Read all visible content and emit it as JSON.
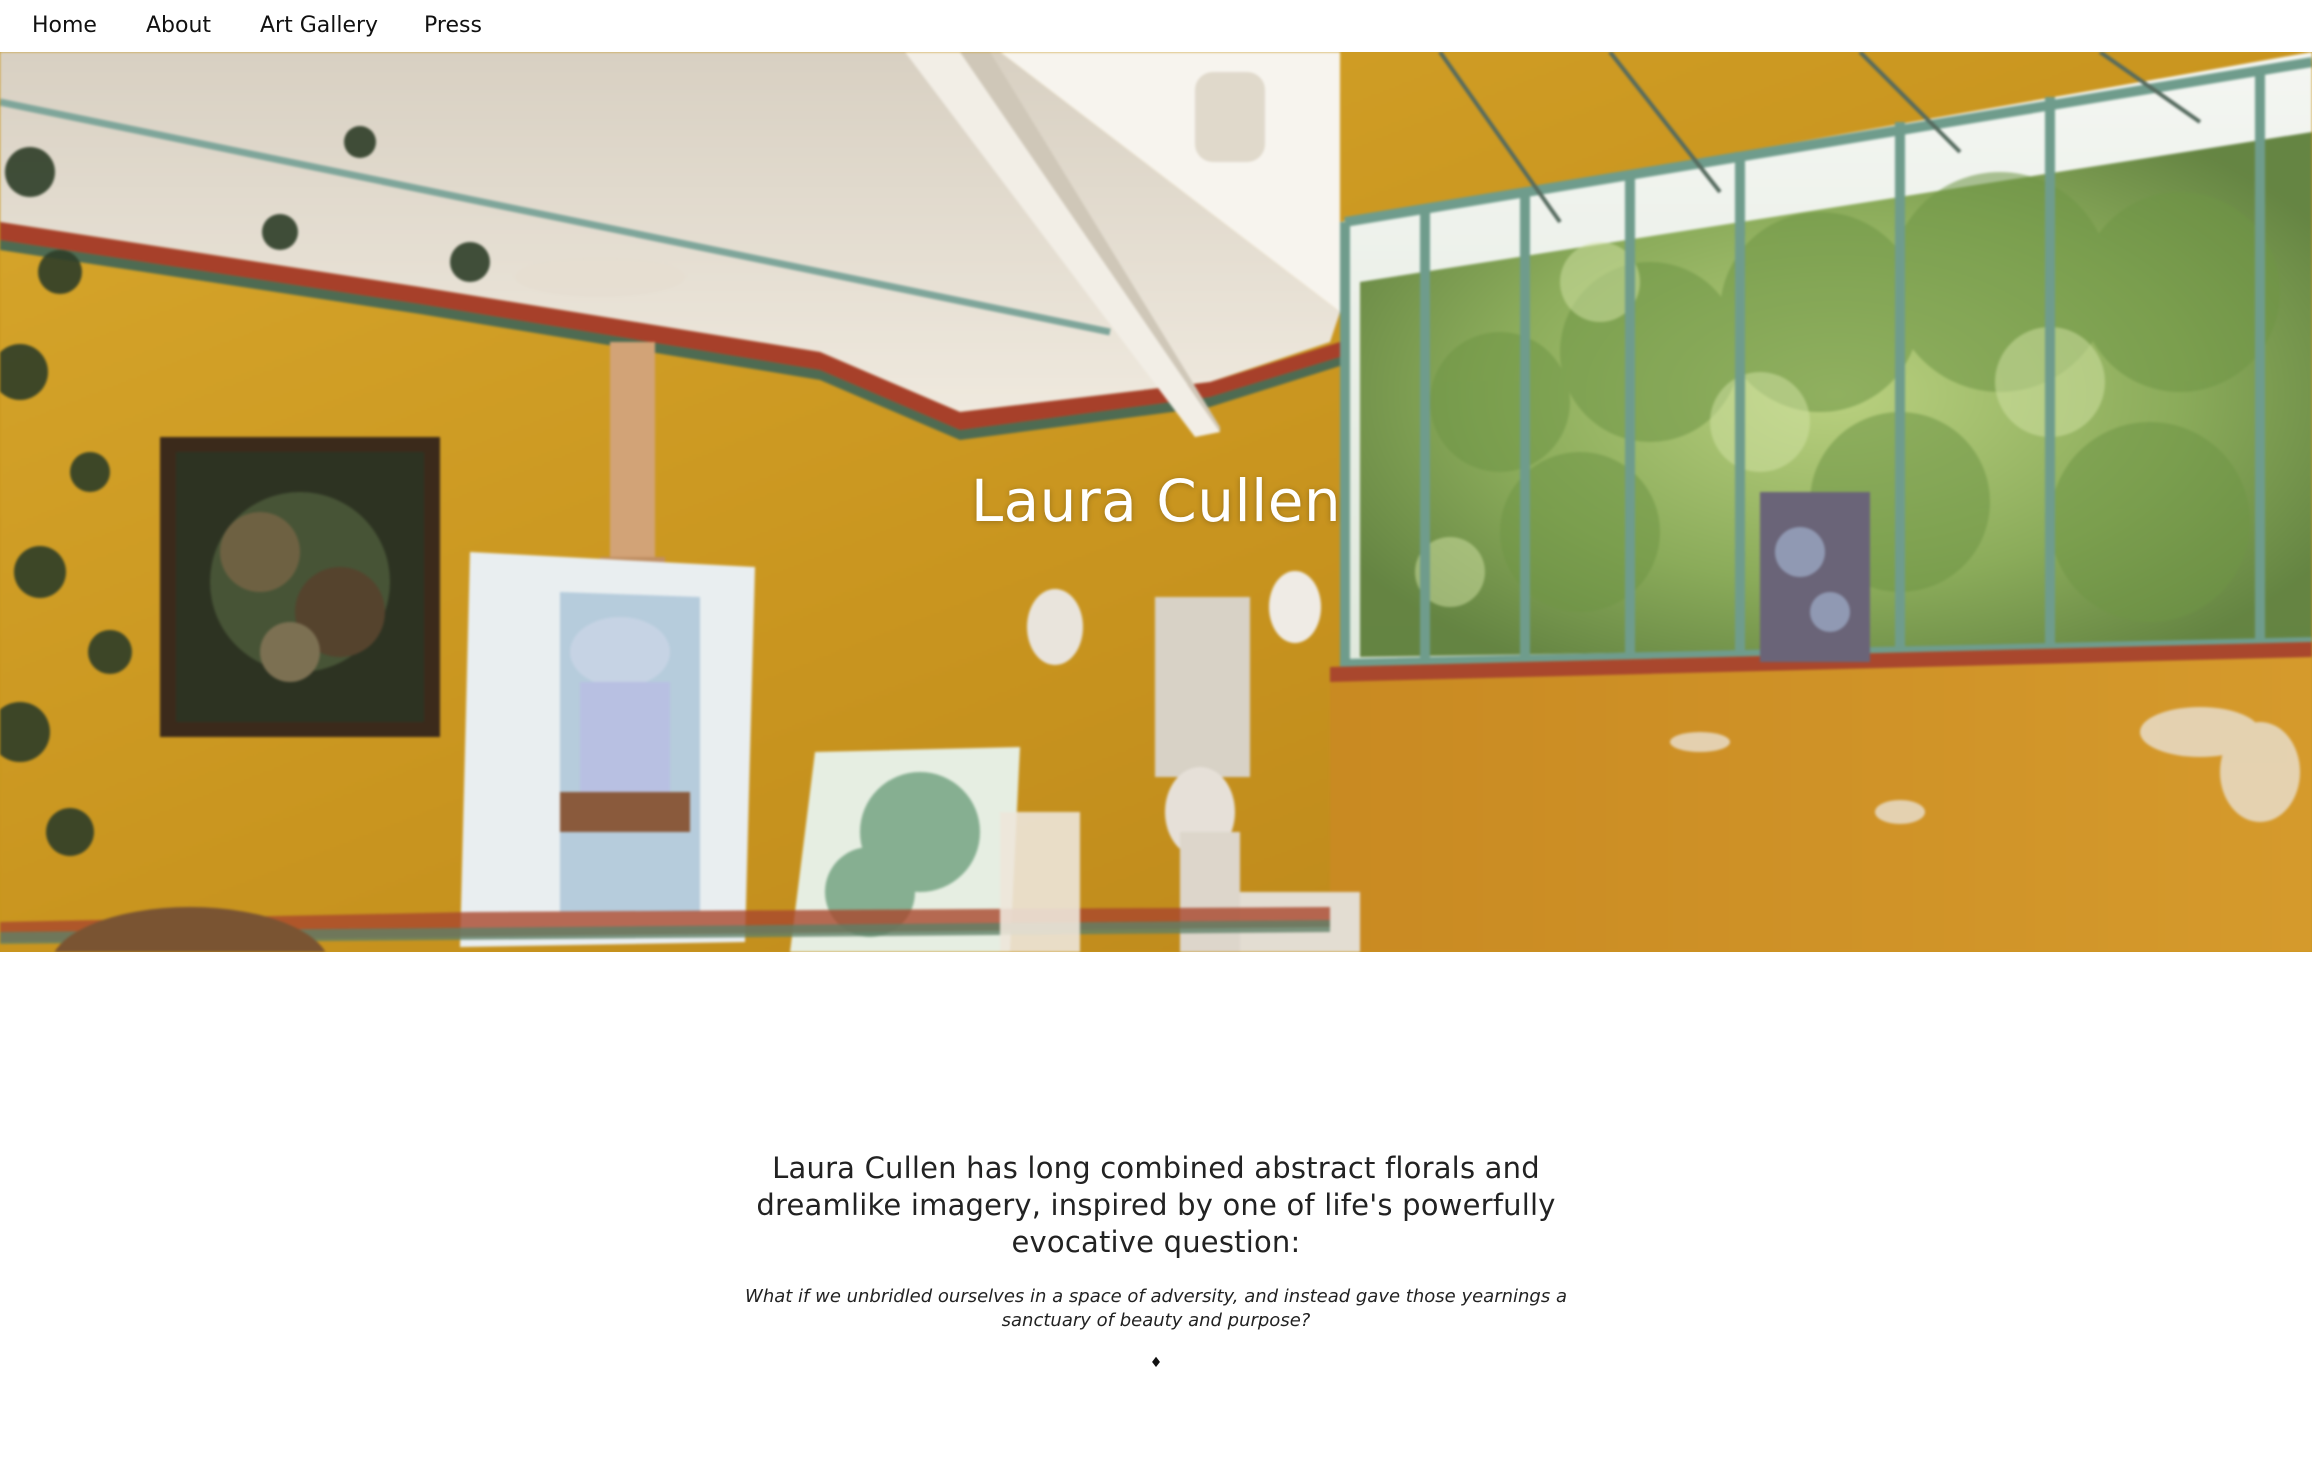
{
  "nav": {
    "items": [
      {
        "label": "Home"
      },
      {
        "label": "About"
      },
      {
        "label": "Art Gallery"
      },
      {
        "label": "Press"
      }
    ]
  },
  "hero": {
    "title": "Laura Cullen"
  },
  "intro": {
    "heading": "Laura Cullen has long combined abstract florals and dreamlike imagery, inspired by one of life's powerfully evocative question:",
    "quote": "What if we unbridled ourselves in a space of adversity, and instead gave those yearnings a sanctuary of beauty and purpose?",
    "divider": "♦"
  },
  "colors": {
    "wall": "#c8961e",
    "window_frame": "#6f9c8c",
    "foliage": "#8fb35a",
    "ceiling": "#e6e0d4"
  }
}
